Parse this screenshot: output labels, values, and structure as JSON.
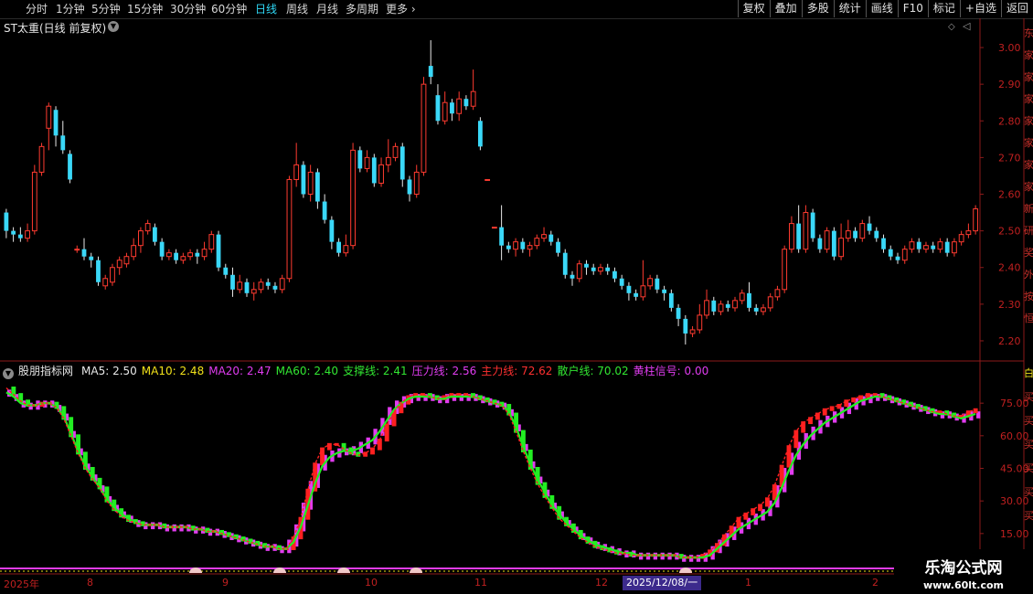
{
  "toolbar": {
    "periods": [
      {
        "label": "分时",
        "x": 28
      },
      {
        "label": "1分钟",
        "x": 61
      },
      {
        "label": "5分钟",
        "x": 100
      },
      {
        "label": "15分钟",
        "x": 139
      },
      {
        "label": "30分钟",
        "x": 186
      },
      {
        "label": "60分钟",
        "x": 231
      },
      {
        "label": "日线",
        "x": 279,
        "active": true
      },
      {
        "label": "周线",
        "x": 313
      },
      {
        "label": "月线",
        "x": 346
      },
      {
        "label": "多周期",
        "x": 378
      },
      {
        "label": "更多",
        "x": 422
      }
    ],
    "more_arrow": "›",
    "actions": [
      "复权",
      "叠加",
      "多股",
      "统计",
      "画线",
      "F10",
      "标记",
      "+自选",
      "返回"
    ]
  },
  "kline": {
    "title": "ST太重(日线 前复权)",
    "price_labels": [
      "3.00",
      "2.90",
      "2.80",
      "2.70",
      "2.60",
      "2.50",
      "2.40",
      "2.30",
      "2.20"
    ],
    "side_chars": [
      "东",
      "家",
      "家",
      "家",
      "家",
      "家",
      "家",
      "家",
      "新",
      "研",
      "奖",
      "外",
      "按",
      "恒"
    ]
  },
  "indicator": {
    "name": "股朋指标网",
    "values": [
      {
        "text": "MA5: 2.50",
        "color": "#e8e8e8"
      },
      {
        "text": "MA10: 2.48",
        "color": "#f2e21a"
      },
      {
        "text": "MA20: 2.47",
        "color": "#e03cf0"
      },
      {
        "text": "MA60: 2.40",
        "color": "#32e632"
      },
      {
        "text": "支撑线: 2.41",
        "color": "#32e632"
      },
      {
        "text": "压力线: 2.56",
        "color": "#e03cf0"
      },
      {
        "text": "主力线: 72.62",
        "color": "#ff3030"
      },
      {
        "text": "散户线: 70.02",
        "color": "#32e632"
      },
      {
        "text": "黄柱信号: 0.00",
        "color": "#e03cf0"
      }
    ],
    "axis_labels": [
      "75.00",
      "60.00",
      "45.00",
      "30.00",
      "15.00"
    ],
    "side_chars": [
      "白",
      "买",
      "买",
      "买",
      "买",
      "买",
      "买"
    ]
  },
  "dates": {
    "labels": [
      {
        "text": "2025年",
        "x": 4
      },
      {
        "text": "8",
        "x": 95
      },
      {
        "text": "9",
        "x": 243
      },
      {
        "text": "10",
        "x": 399
      },
      {
        "text": "11",
        "x": 519
      },
      {
        "text": "12",
        "x": 651
      },
      {
        "text": "1",
        "x": 815
      },
      {
        "text": "2",
        "x": 954
      }
    ],
    "cursor": "2025/12/08/一"
  },
  "watermark": {
    "title": "乐淘公式网",
    "url": "www.60lt.com"
  },
  "colors": {
    "up": "#ff3b30",
    "down": "#3ad8f8",
    "grid": "#8b1a1a",
    "main": "#ff2020",
    "retail": "#22ee22",
    "pink": "#e23cf0"
  },
  "chart_data": [
    {
      "type": "candlestick",
      "title": "ST太重(日线 前复权)",
      "ylim": [
        2.17,
        3.03
      ],
      "price_ticks": [
        3.0,
        2.9,
        2.8,
        2.7,
        2.6,
        2.5,
        2.4,
        2.3,
        2.2
      ],
      "candles": [
        [
          2.55,
          2.5,
          2.56,
          2.48
        ],
        [
          2.5,
          2.49,
          2.51,
          2.47
        ],
        [
          2.49,
          2.48,
          2.51,
          2.47
        ],
        [
          2.48,
          2.5,
          2.52,
          2.47
        ],
        [
          2.5,
          2.66,
          2.68,
          2.49
        ],
        [
          2.66,
          2.73,
          2.74,
          2.65
        ],
        [
          2.78,
          2.84,
          2.85,
          2.72
        ],
        [
          2.83,
          2.76,
          2.84,
          2.73
        ],
        [
          2.76,
          2.72,
          2.8,
          2.71
        ],
        [
          2.71,
          2.64,
          2.72,
          2.63
        ],
        [
          2.45,
          2.45,
          2.46,
          2.44
        ],
        [
          2.45,
          2.43,
          2.48,
          2.42
        ],
        [
          2.43,
          2.42,
          2.44,
          2.4
        ],
        [
          2.42,
          2.36,
          2.43,
          2.35
        ],
        [
          2.35,
          2.37,
          2.38,
          2.34
        ],
        [
          2.36,
          2.4,
          2.41,
          2.35
        ],
        [
          2.4,
          2.42,
          2.43,
          2.38
        ],
        [
          2.41,
          2.43,
          2.44,
          2.4
        ],
        [
          2.43,
          2.46,
          2.48,
          2.42
        ],
        [
          2.46,
          2.5,
          2.51,
          2.44
        ],
        [
          2.5,
          2.52,
          2.53,
          2.49
        ],
        [
          2.51,
          2.47,
          2.52,
          2.46
        ],
        [
          2.47,
          2.43,
          2.48,
          2.42
        ],
        [
          2.43,
          2.44,
          2.45,
          2.42
        ],
        [
          2.44,
          2.42,
          2.45,
          2.41
        ],
        [
          2.42,
          2.43,
          2.44,
          2.41
        ],
        [
          2.43,
          2.44,
          2.45,
          2.42
        ],
        [
          2.44,
          2.43,
          2.45,
          2.41
        ],
        [
          2.43,
          2.45,
          2.47,
          2.42
        ],
        [
          2.45,
          2.49,
          2.5,
          2.44
        ],
        [
          2.49,
          2.4,
          2.5,
          2.39
        ],
        [
          2.4,
          2.38,
          2.41,
          2.37
        ],
        [
          2.38,
          2.34,
          2.4,
          2.32
        ],
        [
          2.34,
          2.36,
          2.38,
          2.33
        ],
        [
          2.36,
          2.33,
          2.37,
          2.32
        ],
        [
          2.33,
          2.34,
          2.36,
          2.31
        ],
        [
          2.34,
          2.36,
          2.37,
          2.33
        ],
        [
          2.36,
          2.35,
          2.37,
          2.34
        ],
        [
          2.35,
          2.34,
          2.36,
          2.33
        ],
        [
          2.34,
          2.37,
          2.38,
          2.33
        ],
        [
          2.37,
          2.64,
          2.65,
          2.36
        ],
        [
          2.64,
          2.68,
          2.74,
          2.62
        ],
        [
          2.68,
          2.6,
          2.69,
          2.59
        ],
        [
          2.6,
          2.66,
          2.68,
          2.58
        ],
        [
          2.66,
          2.58,
          2.67,
          2.56
        ],
        [
          2.58,
          2.53,
          2.6,
          2.52
        ],
        [
          2.53,
          2.47,
          2.54,
          2.45
        ],
        [
          2.47,
          2.44,
          2.48,
          2.43
        ],
        [
          2.44,
          2.46,
          2.49,
          2.43
        ],
        [
          2.46,
          2.72,
          2.74,
          2.45
        ],
        [
          2.72,
          2.67,
          2.73,
          2.66
        ],
        [
          2.67,
          2.7,
          2.72,
          2.66
        ],
        [
          2.7,
          2.63,
          2.71,
          2.62
        ],
        [
          2.63,
          2.68,
          2.7,
          2.62
        ],
        [
          2.68,
          2.7,
          2.75,
          2.66
        ],
        [
          2.7,
          2.73,
          2.74,
          2.69
        ],
        [
          2.73,
          2.64,
          2.74,
          2.62
        ],
        [
          2.64,
          2.6,
          2.65,
          2.58
        ],
        [
          2.6,
          2.66,
          2.68,
          2.59
        ],
        [
          2.66,
          2.9,
          2.92,
          2.65
        ],
        [
          2.95,
          2.92,
          3.02,
          2.9
        ],
        [
          2.87,
          2.8,
          2.9,
          2.79
        ],
        [
          2.8,
          2.85,
          2.88,
          2.79
        ],
        [
          2.85,
          2.82,
          2.86,
          2.8
        ],
        [
          2.82,
          2.86,
          2.88,
          2.8
        ],
        [
          2.86,
          2.84,
          2.87,
          2.83
        ],
        [
          2.84,
          2.88,
          2.94,
          2.83
        ],
        [
          2.8,
          2.73,
          2.81,
          2.72
        ],
        [
          2.64,
          2.64,
          2.64,
          2.64
        ],
        [
          2.51,
          2.51,
          2.51,
          2.51
        ],
        [
          2.51,
          2.46,
          2.57,
          2.42
        ],
        [
          2.46,
          2.45,
          2.47,
          2.44
        ],
        [
          2.45,
          2.47,
          2.48,
          2.43
        ],
        [
          2.47,
          2.45,
          2.48,
          2.44
        ],
        [
          2.45,
          2.46,
          2.47,
          2.43
        ],
        [
          2.46,
          2.48,
          2.49,
          2.45
        ],
        [
          2.48,
          2.49,
          2.51,
          2.47
        ],
        [
          2.49,
          2.47,
          2.5,
          2.46
        ],
        [
          2.47,
          2.44,
          2.48,
          2.43
        ],
        [
          2.44,
          2.38,
          2.45,
          2.37
        ],
        [
          2.38,
          2.37,
          2.39,
          2.35
        ],
        [
          2.37,
          2.41,
          2.42,
          2.36
        ],
        [
          2.41,
          2.4,
          2.42,
          2.38
        ],
        [
          2.4,
          2.39,
          2.41,
          2.38
        ],
        [
          2.39,
          2.4,
          2.41,
          2.38
        ],
        [
          2.4,
          2.39,
          2.41,
          2.38
        ],
        [
          2.39,
          2.37,
          2.4,
          2.36
        ],
        [
          2.37,
          2.35,
          2.38,
          2.34
        ],
        [
          2.35,
          2.33,
          2.36,
          2.31
        ],
        [
          2.33,
          2.32,
          2.34,
          2.31
        ],
        [
          2.32,
          2.35,
          2.42,
          2.31
        ],
        [
          2.35,
          2.37,
          2.38,
          2.34
        ],
        [
          2.37,
          2.34,
          2.38,
          2.33
        ],
        [
          2.34,
          2.33,
          2.35,
          2.31
        ],
        [
          2.33,
          2.29,
          2.34,
          2.28
        ],
        [
          2.29,
          2.26,
          2.3,
          2.24
        ],
        [
          2.26,
          2.22,
          2.27,
          2.19
        ],
        [
          2.22,
          2.23,
          2.24,
          2.21
        ],
        [
          2.23,
          2.27,
          2.3,
          2.22
        ],
        [
          2.27,
          2.31,
          2.34,
          2.26
        ],
        [
          2.31,
          2.28,
          2.32,
          2.27
        ],
        [
          2.28,
          2.3,
          2.31,
          2.27
        ],
        [
          2.3,
          2.29,
          2.31,
          2.28
        ],
        [
          2.29,
          2.31,
          2.32,
          2.28
        ],
        [
          2.31,
          2.33,
          2.34,
          2.3
        ],
        [
          2.33,
          2.29,
          2.36,
          2.28
        ],
        [
          2.29,
          2.28,
          2.3,
          2.27
        ],
        [
          2.28,
          2.29,
          2.3,
          2.27
        ],
        [
          2.29,
          2.32,
          2.33,
          2.28
        ],
        [
          2.32,
          2.34,
          2.35,
          2.31
        ],
        [
          2.34,
          2.45,
          2.46,
          2.33
        ],
        [
          2.45,
          2.52,
          2.54,
          2.44
        ],
        [
          2.52,
          2.45,
          2.57,
          2.44
        ],
        [
          2.45,
          2.55,
          2.57,
          2.44
        ],
        [
          2.55,
          2.48,
          2.56,
          2.47
        ],
        [
          2.48,
          2.45,
          2.49,
          2.44
        ],
        [
          2.45,
          2.5,
          2.51,
          2.44
        ],
        [
          2.5,
          2.43,
          2.51,
          2.42
        ],
        [
          2.43,
          2.48,
          2.52,
          2.42
        ],
        [
          2.48,
          2.5,
          2.53,
          2.47
        ],
        [
          2.5,
          2.48,
          2.51,
          2.47
        ],
        [
          2.48,
          2.52,
          2.53,
          2.47
        ],
        [
          2.52,
          2.5,
          2.54,
          2.49
        ],
        [
          2.5,
          2.48,
          2.51,
          2.47
        ],
        [
          2.48,
          2.45,
          2.49,
          2.44
        ],
        [
          2.45,
          2.43,
          2.46,
          2.42
        ],
        [
          2.43,
          2.42,
          2.44,
          2.41
        ],
        [
          2.42,
          2.45,
          2.46,
          2.41
        ],
        [
          2.45,
          2.47,
          2.48,
          2.44
        ],
        [
          2.47,
          2.45,
          2.48,
          2.44
        ],
        [
          2.45,
          2.46,
          2.47,
          2.44
        ],
        [
          2.46,
          2.45,
          2.47,
          2.44
        ],
        [
          2.45,
          2.47,
          2.48,
          2.44
        ],
        [
          2.47,
          2.44,
          2.48,
          2.43
        ],
        [
          2.44,
          2.47,
          2.48,
          2.43
        ],
        [
          2.47,
          2.49,
          2.5,
          2.46
        ],
        [
          2.49,
          2.5,
          2.52,
          2.48
        ],
        [
          2.5,
          2.56,
          2.57,
          2.49
        ]
      ]
    },
    {
      "type": "line",
      "title": "股朋指标网",
      "ylim": [
        4,
        86
      ],
      "ticks": [
        75,
        60,
        45,
        30,
        15
      ],
      "series": [
        {
          "name": "主力线",
          "values": [
            82,
            79,
            76,
            74,
            74,
            75,
            75,
            73,
            68,
            60,
            52,
            45,
            40,
            36,
            30,
            26,
            23,
            21,
            20,
            19,
            19,
            19,
            18,
            18,
            18,
            18,
            17,
            17,
            16,
            16,
            15,
            14,
            13,
            12,
            11,
            10,
            9,
            9,
            8,
            8,
            13,
            22,
            35,
            47,
            54,
            56,
            56,
            54,
            52,
            51,
            52,
            54,
            58,
            65,
            71,
            75,
            78,
            79,
            79,
            78,
            77,
            78,
            79,
            79,
            79,
            78,
            77,
            76,
            75,
            74,
            70,
            62,
            53,
            45,
            38,
            32,
            27,
            22,
            19,
            16,
            13,
            11,
            9,
            8,
            7,
            6,
            6,
            5,
            5,
            5,
            5,
            5,
            5,
            5,
            4,
            4,
            4,
            5,
            7,
            10,
            14,
            18,
            22,
            24,
            26,
            28,
            31,
            37,
            46,
            55,
            62,
            66,
            68,
            70,
            72,
            73,
            74,
            76,
            77,
            78,
            79,
            79,
            78,
            77,
            76,
            75,
            74,
            73,
            72,
            71,
            71,
            70,
            69,
            69,
            71,
            72
          ]
        },
        {
          "name": "散户线",
          "values": [
            80,
            78,
            75,
            74,
            74,
            75,
            75,
            73,
            69,
            61,
            53,
            46,
            41,
            36,
            31,
            27,
            24,
            22,
            20,
            19,
            19,
            19,
            18,
            18,
            18,
            18,
            17,
            17,
            16,
            16,
            15,
            14,
            13,
            12,
            11,
            10,
            9,
            9,
            8,
            8,
            11,
            18,
            28,
            38,
            46,
            50,
            52,
            53,
            53,
            54,
            56,
            58,
            62,
            67,
            72,
            75,
            77,
            78,
            78,
            78,
            77,
            77,
            78,
            78,
            78,
            78,
            77,
            76,
            75,
            74,
            71,
            64,
            55,
            47,
            40,
            34,
            28,
            24,
            20,
            17,
            14,
            12,
            10,
            9,
            8,
            7,
            6,
            6,
            5,
            5,
            5,
            5,
            5,
            5,
            4,
            4,
            4,
            4,
            5,
            8,
            11,
            14,
            17,
            19,
            21,
            23,
            25,
            29,
            36,
            44,
            51,
            56,
            60,
            63,
            66,
            68,
            70,
            72,
            74,
            76,
            77,
            78,
            78,
            77,
            76,
            75,
            74,
            73,
            72,
            71,
            70,
            70,
            69,
            68,
            69,
            70
          ]
        }
      ]
    }
  ]
}
